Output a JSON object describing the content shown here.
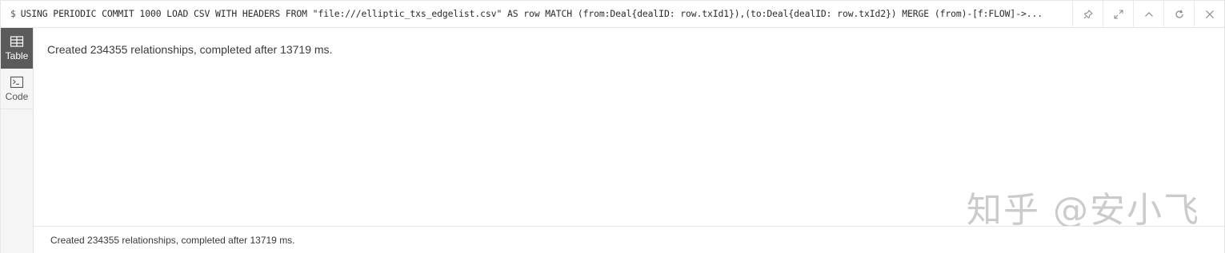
{
  "command": {
    "prompt": "$",
    "text": "USING PERIODIC COMMIT 1000 LOAD CSV WITH HEADERS FROM \"file:///elliptic_txs_edgelist.csv\" AS row MATCH (from:Deal{dealID: row.txId1}),(to:Deal{dealID: row.txId2}) MERGE (from)-[f:FLOW]->..."
  },
  "actions": [
    {
      "name": "pin",
      "icon": "pin-icon"
    },
    {
      "name": "expand",
      "icon": "expand-icon"
    },
    {
      "name": "collapse",
      "icon": "chevron-up-icon"
    },
    {
      "name": "rerun",
      "icon": "refresh-icon"
    },
    {
      "name": "close",
      "icon": "close-icon"
    }
  ],
  "tabs": [
    {
      "label": "Table",
      "icon": "table-icon",
      "active": true
    },
    {
      "label": "Code",
      "icon": "code-icon",
      "active": false
    }
  ],
  "result": {
    "message": "Created 234355 relationships, completed after 13719 ms."
  },
  "footer": {
    "message": "Created 234355 relationships, completed after 13719 ms."
  },
  "watermark": {
    "text": "知乎 @安小飞"
  },
  "colors": {
    "active_tab_bg": "#5b5b5b",
    "rail_bg": "#f5f5f5",
    "text": "#3a3a3a"
  }
}
